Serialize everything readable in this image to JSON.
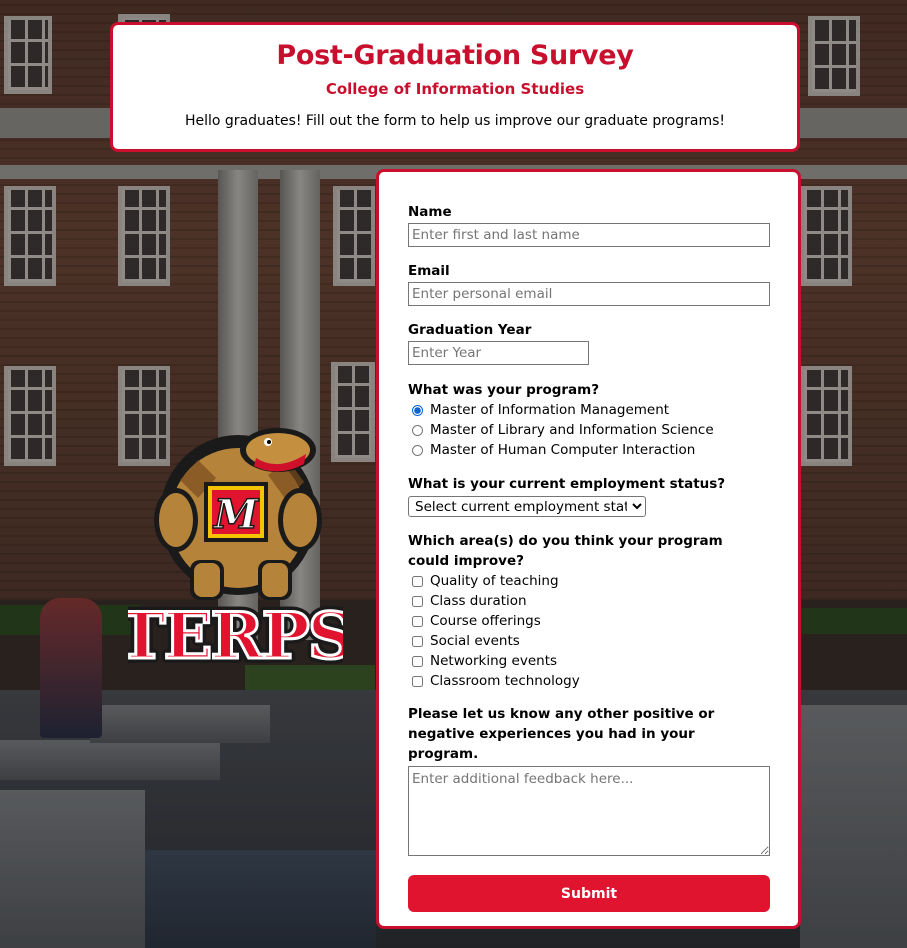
{
  "header": {
    "title": "Post-Graduation Survey",
    "subtitle": "College of Information Studies",
    "intro": "Hello graduates! Fill out the form to help us improve our graduate programs!"
  },
  "form": {
    "name": {
      "label": "Name",
      "placeholder": "Enter first and last name",
      "value": ""
    },
    "email": {
      "label": "Email",
      "placeholder": "Enter personal email",
      "value": ""
    },
    "year": {
      "label": "Graduation Year",
      "placeholder": "Enter Year",
      "value": ""
    },
    "program": {
      "label": "What was your program?",
      "options": [
        {
          "label": "Master of Information Management",
          "checked": true
        },
        {
          "label": "Master of Library and Information Science",
          "checked": false
        },
        {
          "label": "Master of Human Computer Interaction",
          "checked": false
        }
      ]
    },
    "employment": {
      "label": "What is your current employment status?",
      "selected": "Select current employment status"
    },
    "improve": {
      "label": "Which area(s) do you think your program could improve?",
      "options": [
        {
          "label": "Quality of teaching",
          "checked": false
        },
        {
          "label": "Class duration",
          "checked": false
        },
        {
          "label": "Course offerings",
          "checked": false
        },
        {
          "label": "Social events",
          "checked": false
        },
        {
          "label": "Networking events",
          "checked": false
        },
        {
          "label": "Classroom technology",
          "checked": false
        }
      ]
    },
    "feedback": {
      "label": "Please let us know any other positive or negative experiences you had in your program.",
      "placeholder": "Enter additional feedback here..."
    },
    "submit_label": "Submit"
  },
  "logo": {
    "wordmark": "TERPS",
    "letter": "M"
  },
  "colors": {
    "accent": "#c8102e",
    "button": "#e0142f",
    "logo_yellow": "#f5c400"
  }
}
